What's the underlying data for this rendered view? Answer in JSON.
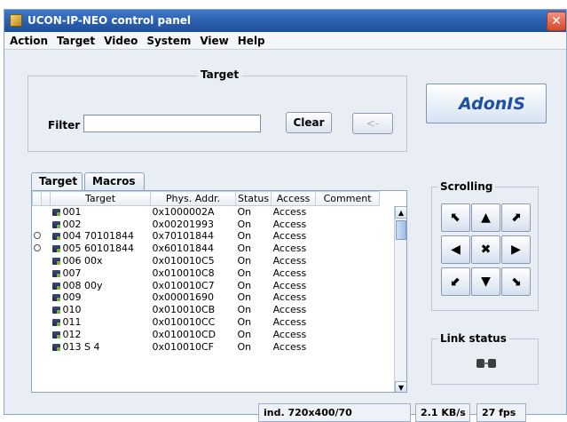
{
  "window": {
    "title": "UCON-IP-NEO control panel",
    "close_glyph": "✕"
  },
  "menu": [
    "Action",
    "Target",
    "Video",
    "System",
    "View",
    "Help"
  ],
  "target_section": {
    "legend": "Target",
    "filter_label": "Filter",
    "filter_value": "",
    "clear_label": "Clear",
    "back_label": "<-"
  },
  "logo": {
    "text": "AdonIS"
  },
  "tabs": [
    {
      "label": "Target",
      "active": true
    },
    {
      "label": "Macros",
      "active": false
    }
  ],
  "table": {
    "columns": [
      "Target",
      "Phys. Addr.",
      "Status",
      "Access",
      "Comment"
    ],
    "rows": [
      {
        "indicator": "",
        "target": "001",
        "addr": "0x1000002A",
        "status": "On",
        "access": "Access",
        "comment": ""
      },
      {
        "indicator": "",
        "target": "002",
        "addr": "0x00201993",
        "status": "On",
        "access": "Access",
        "comment": ""
      },
      {
        "indicator": "lock",
        "target": "004 70101844",
        "addr": "0x70101844",
        "status": "On",
        "access": "Access",
        "comment": ""
      },
      {
        "indicator": "lock",
        "target": "005 60101844",
        "addr": "0x60101844",
        "status": "On",
        "access": "Access",
        "comment": ""
      },
      {
        "indicator": "",
        "target": "006 00x",
        "addr": "0x010010C5",
        "status": "On",
        "access": "Access",
        "comment": ""
      },
      {
        "indicator": "",
        "target": "007",
        "addr": "0x010010C8",
        "status": "On",
        "access": "Access",
        "comment": ""
      },
      {
        "indicator": "",
        "target": "008 00y",
        "addr": "0x010010C7",
        "status": "On",
        "access": "Access",
        "comment": ""
      },
      {
        "indicator": "",
        "target": "009",
        "addr": "0x00001690",
        "status": "On",
        "access": "Access",
        "comment": ""
      },
      {
        "indicator": "",
        "target": "010",
        "addr": "0x010010CB",
        "status": "On",
        "access": "Access",
        "comment": ""
      },
      {
        "indicator": "",
        "target": "011",
        "addr": "0x010010CC",
        "status": "On",
        "access": "Access",
        "comment": ""
      },
      {
        "indicator": "",
        "target": "012",
        "addr": "0x010010CD",
        "status": "On",
        "access": "Access",
        "comment": ""
      },
      {
        "indicator": "",
        "target": "013 S 4",
        "addr": "0x010010CF",
        "status": "On",
        "access": "Access",
        "comment": ""
      }
    ]
  },
  "scrolling": {
    "legend": "Scrolling",
    "buttons": [
      {
        "name": "scroll-up-left-icon",
        "glyph": "⬉"
      },
      {
        "name": "scroll-up-icon",
        "glyph": "▲"
      },
      {
        "name": "scroll-up-right-icon",
        "glyph": "⬈"
      },
      {
        "name": "scroll-left-icon",
        "glyph": "◀"
      },
      {
        "name": "scroll-center-icon",
        "glyph": "✖"
      },
      {
        "name": "scroll-right-icon",
        "glyph": "▶"
      },
      {
        "name": "scroll-down-left-icon",
        "glyph": "⬋"
      },
      {
        "name": "scroll-down-icon",
        "glyph": "▼"
      },
      {
        "name": "scroll-down-right-icon",
        "glyph": "⬊"
      }
    ]
  },
  "link_status": {
    "legend": "Link status",
    "icon": "link-connector-icon"
  },
  "status_bar": {
    "resolution": "ind. 720x400/70",
    "bandwidth": "2.1 KB/s",
    "fps": "27 fps"
  },
  "colors": {
    "title_bar": "#2a5fae",
    "accent": "#1d4fa3",
    "close_button": "#d54a2a"
  }
}
